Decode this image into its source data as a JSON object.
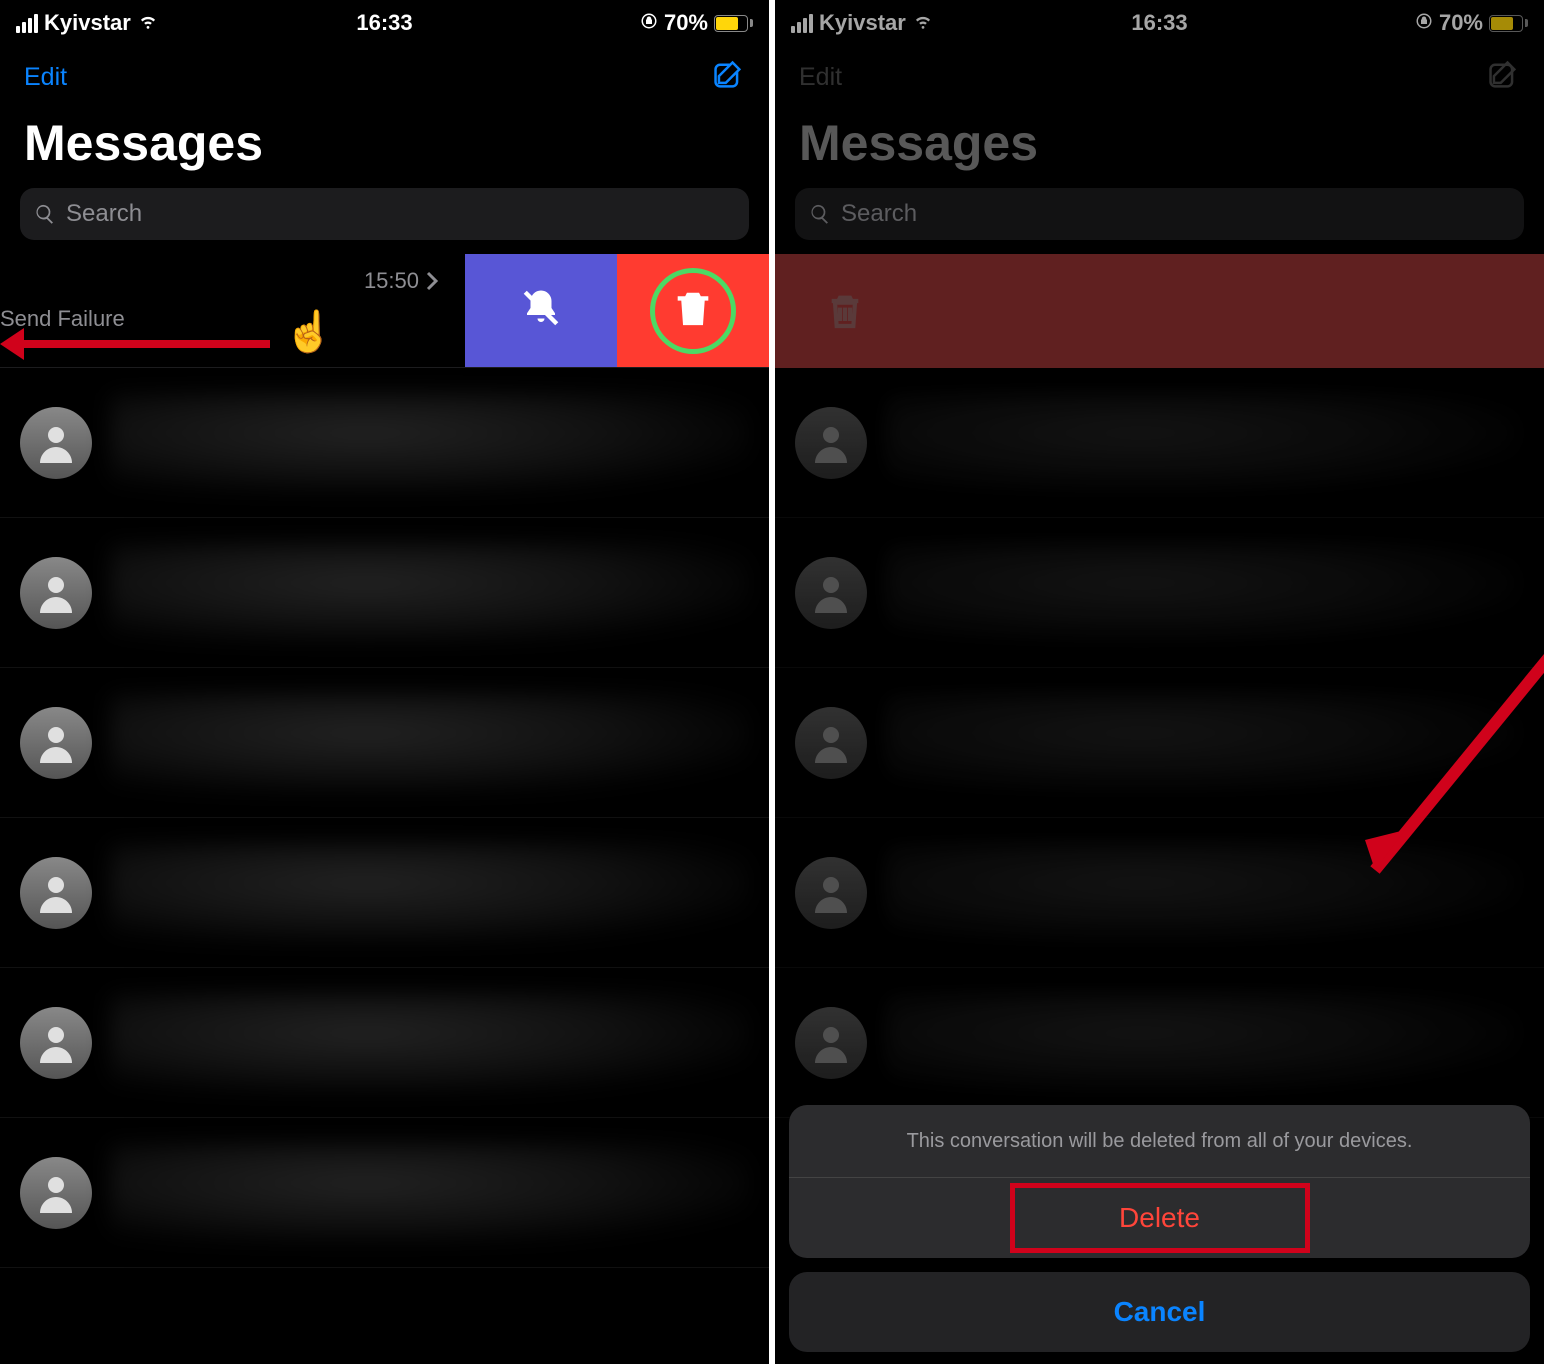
{
  "statusbar": {
    "carrier": "Kyivstar",
    "time": "16:33",
    "battery_pct": "70%"
  },
  "nav": {
    "edit": "Edit"
  },
  "title": "Messages",
  "search": {
    "placeholder": "Search"
  },
  "swiped": {
    "time": "15:50",
    "status": "Send Failure"
  },
  "sheet": {
    "text": "This conversation will be deleted from all of your devices.",
    "delete": "Delete",
    "cancel": "Cancel"
  }
}
